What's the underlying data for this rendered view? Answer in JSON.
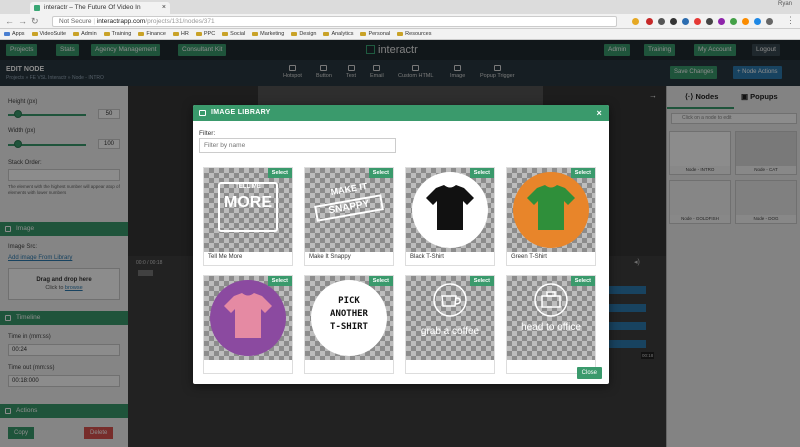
{
  "browser": {
    "tab_title": "interactr – The Future Of Video In",
    "user_name": "Ryan",
    "security_label": "Not Secure",
    "url_domain": "interactrapp.com",
    "url_path": "/projects/131/nodes/371",
    "bookmarks": [
      "Apps",
      "VideoSuite",
      "Admin",
      "Training",
      "Finance",
      "HR",
      "PPC",
      "Social",
      "Marketing",
      "Design",
      "Analytics",
      "Personal",
      "Resources"
    ]
  },
  "appnav": {
    "left_buttons": [
      "Projects",
      "Stats",
      "Agency Management",
      "Consultant Kit"
    ],
    "brand": "interactr",
    "right_buttons": [
      "Admin",
      "Training",
      "My Account",
      "Logout"
    ]
  },
  "editor": {
    "title": "EDIT NODE",
    "breadcrumb": "Projects  »  FE VSL Interactr  »  Node - INTRO",
    "tools": [
      "Hotspot",
      "Button",
      "Text",
      "Email",
      "Custom HTML",
      "Image",
      "Popup Trigger"
    ],
    "save_label": "Save Changes",
    "node_actions_label": "+ Node Actions"
  },
  "left": {
    "height_label": "Height (px)",
    "height_value": "50",
    "width_label": "Width (px)",
    "width_value": "100",
    "stack_label": "Stack Order:",
    "stack_help": "The element with the highest number will appear atop of elements with lower numbers",
    "image_section": "Image",
    "image_src_label": "Image Src:",
    "add_from_library": "Add image From Library",
    "drop_title": "Drag and drop here",
    "drop_sub_prefix": "Click to",
    "drop_sub_link": "browse",
    "timeline_section": "Timeline",
    "time_in_label": "Time in (mm:ss)",
    "time_in_value": "00:24",
    "time_out_label": "Time out (mm:ss)",
    "time_out_value": "00:18:000",
    "actions_section": "Actions",
    "copy_label": "Copy",
    "delete_label": "Delete"
  },
  "canvas": {
    "timecode": "00:0 / 00:18",
    "end_marker": "00:18"
  },
  "right": {
    "tab_nodes": "Nodes",
    "tab_popups": "Popups",
    "search_placeholder": "Click on a node to edit",
    "nodes": [
      "Node - INTRO",
      "Node - CAT",
      "Node - GOLDFISH",
      "Node - DOG"
    ]
  },
  "modal": {
    "title": "IMAGE LIBRARY",
    "filter_label": "Filter:",
    "filter_placeholder": "Filter by name",
    "select_label": "Select",
    "close_label": "Close",
    "images": [
      {
        "caption": "Tell Me More",
        "art_top": "TELL ME",
        "art_main": "MORE"
      },
      {
        "caption": "Make It Snappy",
        "art_top": "MAKE IT",
        "art_main": "SNAPPY"
      },
      {
        "caption": "Black T-Shirt",
        "shirt_color": "#111111",
        "circle_color": "#ffffff"
      },
      {
        "caption": "Green T-Shirt",
        "shirt_color": "#2f8f3a",
        "circle_color": "#e8852a"
      },
      {
        "caption": "",
        "shirt_color": "#e58aa3",
        "circle_color": "#8b4aa0"
      },
      {
        "caption": "",
        "art_lines": [
          "PICK",
          "ANOTHER",
          "T-SHIRT"
        ]
      },
      {
        "caption": "",
        "art_main": "grab a coffee"
      },
      {
        "caption": "",
        "art_main": "head to office"
      }
    ]
  },
  "colors": {
    "accent": "#3a9a6c",
    "nav_bg": "#1f2a30",
    "delete": "#d9534f",
    "timeline_bar": "#2d7bb0"
  }
}
